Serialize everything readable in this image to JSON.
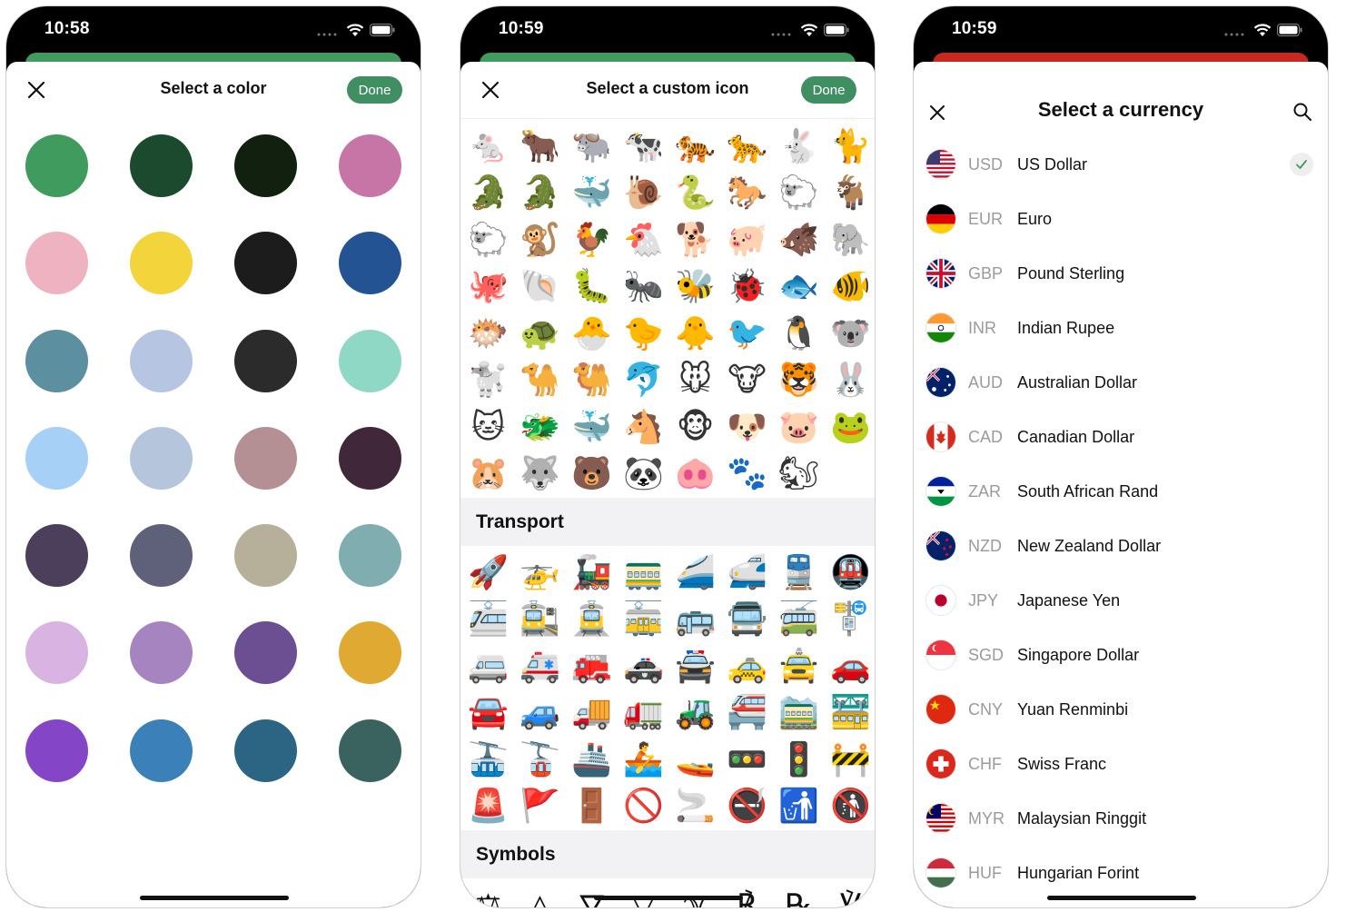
{
  "screens": [
    {
      "status": {
        "time": "10:58"
      },
      "sheet_accent": "#3f9b5e",
      "title": "Select a color",
      "done_label": "Done",
      "colors": [
        "#3f9b5e",
        "#1b4a2e",
        "#11200f",
        "#c775a6",
        "#efb2c0",
        "#f3d43a",
        "#1c1c1c",
        "#235393",
        "#5c8fa0",
        "#b6c6e2",
        "#2b2b2b",
        "#8fd8c6",
        "#a6d0f5",
        "#b5c6dc",
        "#b49095",
        "#40283a",
        "#4c3f5c",
        "#5f6079",
        "#b6b09a",
        "#7fadb0",
        "#d9b3e2",
        "#a684c0",
        "#6b4f92",
        "#e0a931",
        "#8446c6",
        "#3b80b8",
        "#2c6583",
        "#3a6360"
      ]
    },
    {
      "status": {
        "time": "10:59"
      },
      "sheet_accent": "#3f9b5e",
      "title": "Select a custom icon",
      "done_label": "Done",
      "animal_icons": [
        "🐁",
        "🐂",
        "🐃",
        "🐄",
        "🐅",
        "🐆",
        "🐇",
        "🐈",
        "🐊",
        "🐊",
        "🐳",
        "🐌",
        "🐍",
        "🐎",
        "🐑",
        "🐐",
        "🐑",
        "🐒",
        "🐓",
        "🐔",
        "🐕",
        "🐖",
        "🐗",
        "🐘",
        "🐙",
        "🐚",
        "🐛",
        "🐜",
        "🐝",
        "🐞",
        "🐟",
        "🐠",
        "🐡",
        "🐢",
        "🐣",
        "🐤",
        "🐥",
        "🐦",
        "🐧",
        "🐨",
        "🐩",
        "🐪",
        "🐫",
        "🐬",
        "🐭",
        "🐮",
        "🐯",
        "🐰",
        "🐱",
        "🐲",
        "🐳",
        "🐴",
        "🐵",
        "🐶",
        "🐷",
        "🐸",
        "🐹",
        "🐺",
        "🐻",
        "🐼",
        "🐽",
        "🐾",
        "🐿"
      ],
      "transport_header": "Transport",
      "transport_icons": [
        "🚀",
        "🚁",
        "🚂",
        "🚃",
        "🚄",
        "🚅",
        "🚆",
        "🚇",
        "🚈",
        "🚉",
        "🚊",
        "🚋",
        "🚌",
        "🚍",
        "🚎",
        "🚏",
        "🚐",
        "🚑",
        "🚒",
        "🚓",
        "🚔",
        "🚕",
        "🚖",
        "🚗",
        "🚘",
        "🚙",
        "🚚",
        "🚛",
        "🚜",
        "🚝",
        "🚞",
        "🚟",
        "🚠",
        "🚡",
        "🚢",
        "🚣",
        "🚤",
        "🚥",
        "🚦",
        "🚧",
        "🚨",
        "🚩",
        "🚪",
        "🚫",
        "🚬",
        "🚭",
        "🚮",
        "🚯"
      ],
      "symbols_header": "Symbols",
      "symbol_icons": [
        "⚖",
        "△",
        "⛛",
        "▽",
        "ℽ",
        "℟",
        "℞",
        "℣"
      ]
    },
    {
      "status": {
        "time": "10:59"
      },
      "sheet_accent": "#c8281e",
      "title": "Select a currency",
      "currencies": [
        {
          "code": "USD",
          "name": "US Dollar",
          "flag": "us",
          "selected": true
        },
        {
          "code": "EUR",
          "name": "Euro",
          "flag": "de",
          "selected": false
        },
        {
          "code": "GBP",
          "name": "Pound Sterling",
          "flag": "gb",
          "selected": false
        },
        {
          "code": "INR",
          "name": "Indian Rupee",
          "flag": "in",
          "selected": false
        },
        {
          "code": "AUD",
          "name": "Australian Dollar",
          "flag": "au",
          "selected": false
        },
        {
          "code": "CAD",
          "name": "Canadian Dollar",
          "flag": "ca",
          "selected": false
        },
        {
          "code": "ZAR",
          "name": "South African Rand",
          "flag": "za",
          "selected": false
        },
        {
          "code": "NZD",
          "name": "New Zealand Dollar",
          "flag": "nz",
          "selected": false
        },
        {
          "code": "JPY",
          "name": "Japanese Yen",
          "flag": "jp",
          "selected": false
        },
        {
          "code": "SGD",
          "name": "Singapore Dollar",
          "flag": "sg",
          "selected": false
        },
        {
          "code": "CNY",
          "name": "Yuan Renminbi",
          "flag": "cn",
          "selected": false
        },
        {
          "code": "CHF",
          "name": "Swiss Franc",
          "flag": "ch",
          "selected": false
        },
        {
          "code": "MYR",
          "name": "Malaysian Ringgit",
          "flag": "my",
          "selected": false
        },
        {
          "code": "HUF",
          "name": "Hungarian Forint",
          "flag": "hu",
          "selected": false
        }
      ]
    }
  ]
}
